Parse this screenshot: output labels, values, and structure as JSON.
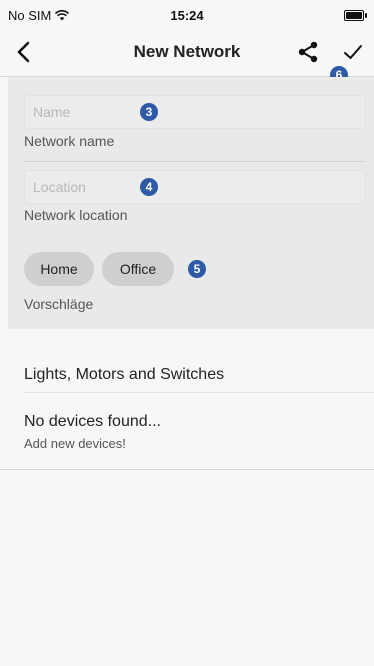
{
  "status_bar": {
    "carrier": "No SIM",
    "time": "15:24"
  },
  "nav": {
    "title": "New Network",
    "back_icon": "chevron-left-icon",
    "share_icon": "share-icon",
    "save_icon": "checkmark-icon"
  },
  "form": {
    "name": {
      "placeholder": "Name",
      "value": "",
      "helper": "Network name"
    },
    "location": {
      "placeholder": "Location",
      "value": "",
      "helper": "Network location"
    },
    "suggestions": {
      "chips": [
        "Home",
        "Office"
      ],
      "label": "Vorschläge"
    }
  },
  "badges": [
    "3",
    "4",
    "5",
    "6"
  ],
  "devices": {
    "header": "Lights, Motors and Switches",
    "empty_title": "No devices found...",
    "empty_subtitle": "Add new devices!"
  },
  "colors": {
    "badge": "#2f5aa8",
    "form_bg": "#e9e9e9",
    "chip_bg": "#cfcfcf"
  }
}
